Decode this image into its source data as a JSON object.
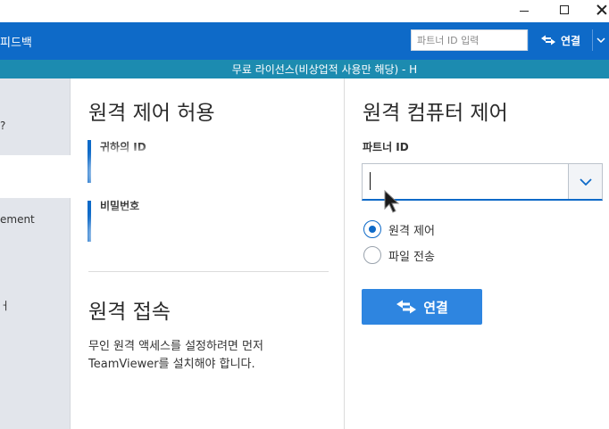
{
  "header": {
    "feedback_label": "피드백",
    "partner_id_placeholder": "파트너 ID 입력",
    "connect_label": "연결"
  },
  "license_banner": "무료 라이선스(비상업적 사용만 해당) - H",
  "sidebar": {
    "items": [
      {
        "label": "?"
      },
      {
        "label": "ement"
      },
      {
        "label": "ㅓ"
      }
    ]
  },
  "allow_remote": {
    "title": "원격 제어 허용",
    "your_id_label": "귀하의 ID",
    "password_label": "비밀번호"
  },
  "remote_access": {
    "title": "원격 접속",
    "description": "무인 원격 액세스를 설정하려면 먼저 TeamViewer를 설치해야 합니다."
  },
  "control_remote": {
    "title": "원격 컴퓨터 제어",
    "partner_id_label": "파트너 ID",
    "partner_id_value": "",
    "options": [
      {
        "label": "원격 제어",
        "checked": true
      },
      {
        "label": "파일 전송",
        "checked": false
      }
    ],
    "connect_label": "연결"
  },
  "colors": {
    "header_blue": "#0e6ac8",
    "banner_teal": "#1c8bb0",
    "button_blue": "#2e85e0"
  }
}
